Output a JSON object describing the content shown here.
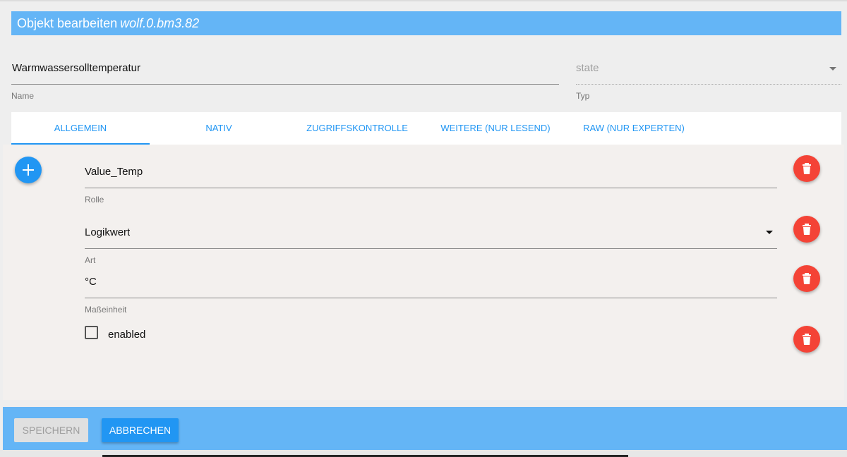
{
  "title": {
    "prefix": "Objekt bearbeiten",
    "object_id": "wolf.0.bm3.82"
  },
  "name_field": {
    "value": "Warmwassersolltemperatur",
    "label": "Name"
  },
  "type_field": {
    "value": "state",
    "label": "Typ",
    "icon": "dropdown-arrow"
  },
  "tabs": [
    {
      "label": "ALLGEMEIN",
      "active": true
    },
    {
      "label": "NATIV"
    },
    {
      "label": "ZUGRIFFSKONTROLLE"
    },
    {
      "label": "WEITERE (NUR LESEND)"
    },
    {
      "label": "RAW (NUR EXPERTEN)"
    }
  ],
  "common": {
    "add_icon": "plus-icon",
    "delete_icon": "trash-icon",
    "role": {
      "value": "Value_Temp",
      "label": "Rolle"
    },
    "type": {
      "value": "Logikwert",
      "label": "Art",
      "icon": "dropdown-arrow"
    },
    "unit": {
      "value": "°C",
      "label": "Maßeinheit"
    },
    "enabled": {
      "label": "enabled",
      "checked": false
    }
  },
  "footer": {
    "save_label": "SPEICHERN",
    "cancel_label": "ABBRECHEN"
  },
  "colors": {
    "header": "#64b5f6",
    "accent": "#2196f3",
    "delete": "#f44336",
    "panel": "#f3f0ee",
    "background": "#eeeeee"
  }
}
